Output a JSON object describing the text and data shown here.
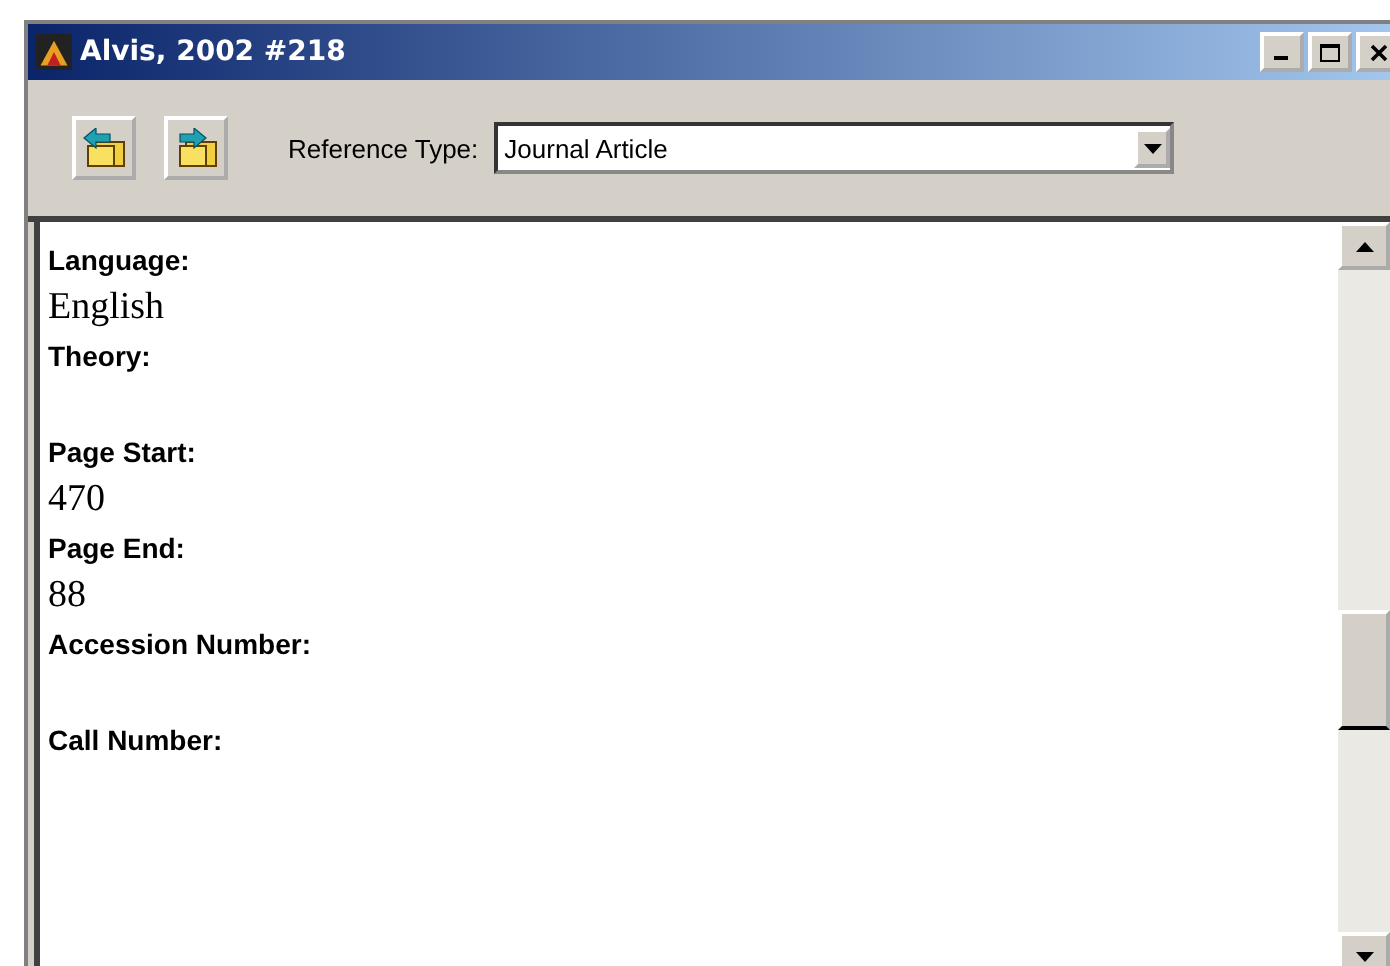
{
  "window": {
    "title": "Alvis, 2002 #218"
  },
  "toolbar": {
    "reference_type_label": "Reference Type:",
    "reference_type": "Journal Article"
  },
  "fields": [
    {
      "label": "Language:",
      "value": "English"
    },
    {
      "label": "Theory:"
    },
    {
      "label": "Page Start:",
      "value": "470"
    },
    {
      "label": "Page End:",
      "value": "88"
    },
    {
      "label": "Accession Number:"
    },
    {
      "label": "Call Number:"
    }
  ]
}
